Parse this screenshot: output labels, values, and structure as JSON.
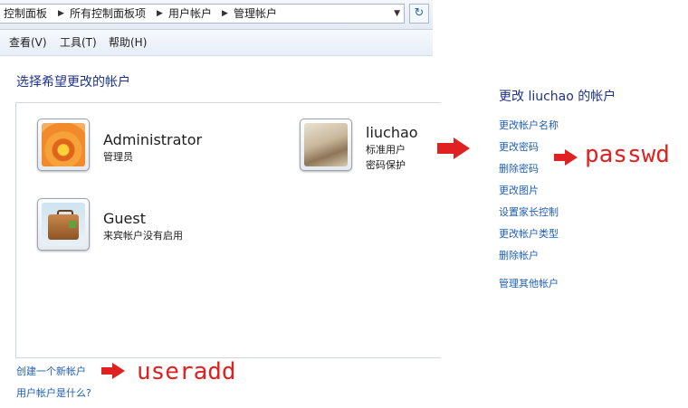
{
  "address_bar": {
    "crumbs": [
      "控制面板",
      "所有控制面板项",
      "用户帐户",
      "管理帐户"
    ],
    "separator_icon": "chevron-right-icon",
    "dropdown_icon": "chevron-down-icon",
    "refresh_icon": "refresh-icon"
  },
  "menu": [
    "查看(V)",
    "工具(T)",
    "帮助(H)"
  ],
  "heading": "选择希望更改的帐户",
  "accounts": [
    {
      "name": "Administrator",
      "lines": [
        "管理员"
      ],
      "picture": "flower-picture"
    },
    {
      "name": "liuchao",
      "lines": [
        "标准用户",
        "密码保护"
      ],
      "picture": "cat-picture"
    },
    {
      "name": "Guest",
      "lines": [
        "来宾帐户没有启用"
      ],
      "picture": "suitcase-picture"
    }
  ],
  "bottom_links": {
    "create": "创建一个新帐户",
    "what_is": "用户帐户是什么?"
  },
  "tasks": {
    "title": "更改 liuchao 的帐户",
    "items": [
      "更改帐户名称",
      "更改密码",
      "删除密码",
      "更改图片",
      "设置家长控制",
      "更改帐户类型",
      "删除帐户"
    ],
    "other": "管理其他帐户"
  },
  "annotations": {
    "passwd": "passwd",
    "useradd": "useradd",
    "color": "#e02121"
  }
}
